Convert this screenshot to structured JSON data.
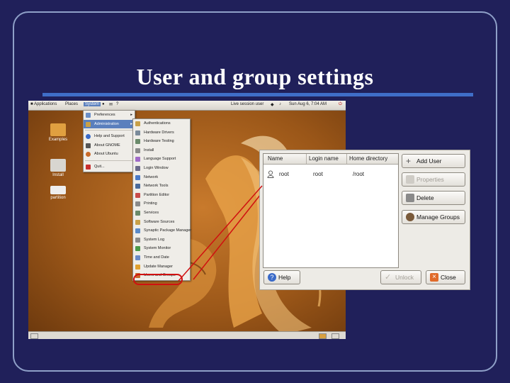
{
  "slide": {
    "title": "User and group settings"
  },
  "desktop": {
    "top_panel": {
      "applications": "Applications",
      "places": "Places",
      "system": "System",
      "session": "Live session user",
      "clock": "Sun Aug 6, 7:04 AM"
    },
    "icons": [
      {
        "name": "folder-icon",
        "label": "Examples"
      },
      {
        "name": "printer-icon",
        "label": "Install"
      },
      {
        "name": "drive-icon",
        "label": "partition"
      }
    ],
    "system_menu": [
      {
        "label": "Preferences",
        "icon": "preferences-icon",
        "submenu": true
      },
      {
        "label": "Administration",
        "icon": "administration-icon",
        "submenu": true,
        "selected": true
      },
      {
        "label": "Help and Support",
        "icon": "help-icon"
      },
      {
        "label": "About GNOME",
        "icon": "gnome-icon"
      },
      {
        "label": "About Ubuntu",
        "icon": "ubuntu-icon"
      },
      {
        "label": "Quit...",
        "icon": "quit-icon"
      }
    ],
    "admin_menu": [
      "Authentications",
      "Hardware Drivers",
      "Hardware Testing",
      "Install",
      "Language Support",
      "Login Window",
      "Network",
      "Network Tools",
      "Partition Editor",
      "Printing",
      "Services",
      "Software Sources",
      "Synaptic Package Manager",
      "System Log",
      "System Monitor",
      "Time and Date",
      "Update Manager",
      "Users and Groups"
    ]
  },
  "dialog": {
    "columns": [
      "Name",
      "Login name",
      "Home directory"
    ],
    "rows": [
      {
        "name": "root",
        "login": "root",
        "home": "/root"
      }
    ],
    "buttons": {
      "add_user": "Add User",
      "properties": "Properties",
      "delete": "Delete",
      "manage_groups": "Manage Groups",
      "help": "Help",
      "unlock": "Unlock",
      "close": "Close"
    }
  },
  "colors": {
    "slide_bg": "#20205a",
    "accent": "#3f6ec8",
    "highlight": "#d01010"
  }
}
